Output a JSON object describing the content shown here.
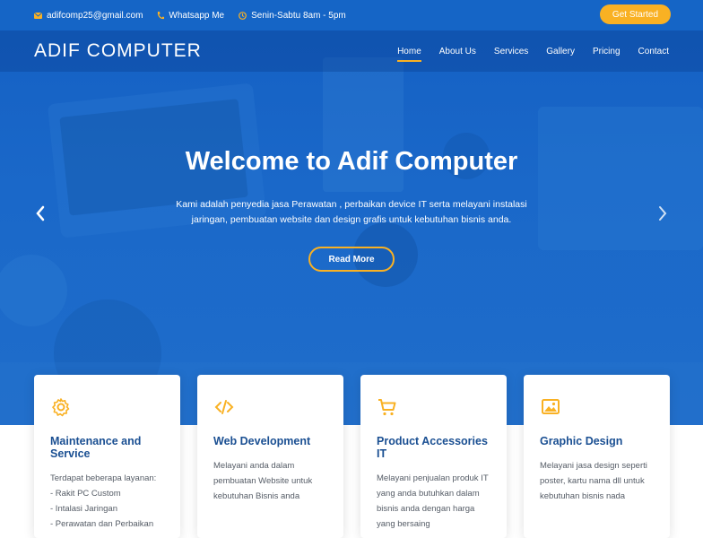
{
  "topbar": {
    "email": "adifcomp25@gmail.com",
    "whatsapp": "Whatsapp Me",
    "hours": "Senin-Sabtu 8am - 5pm",
    "cta": "Get Started"
  },
  "navbar": {
    "brand": "ADIF COMPUTER",
    "links": [
      "Home",
      "About Us",
      "Services",
      "Gallery",
      "Pricing",
      "Contact"
    ]
  },
  "hero": {
    "title": "Welcome to Adif Computer",
    "subtitle": "Kami adalah penyedia jasa Perawatan , perbaikan device IT serta melayani instalasi jaringan, pembuatan website dan design grafis untuk kebutuhan bisnis anda.",
    "button": "Read More"
  },
  "cards": [
    {
      "title": "Maintenance and Service",
      "text": "Terdapat beberapa layanan:",
      "items": [
        "- Rakit PC Custom",
        "- Intalasi Jaringan",
        "- Perawatan dan Perbaikan"
      ],
      "icon": "gear-icon"
    },
    {
      "title": "Web Development",
      "text": "Melayani anda dalam pembuatan Website untuk kebutuhan Bisnis anda",
      "icon": "code-icon"
    },
    {
      "title": "Product Accessories IT",
      "text": "Melayani penjualan produk IT yang anda butuhkan dalam bisnis anda dengan harga yang bersaing",
      "icon": "cart-icon"
    },
    {
      "title": "Graphic Design",
      "text": "Melayani jasa design seperti poster, kartu nama dll untuk kebutuhan bisnis nada",
      "icon": "image-icon"
    }
  ],
  "colors": {
    "primary": "#1565c6",
    "accent": "#f9b123",
    "heading": "#1a4f92"
  }
}
